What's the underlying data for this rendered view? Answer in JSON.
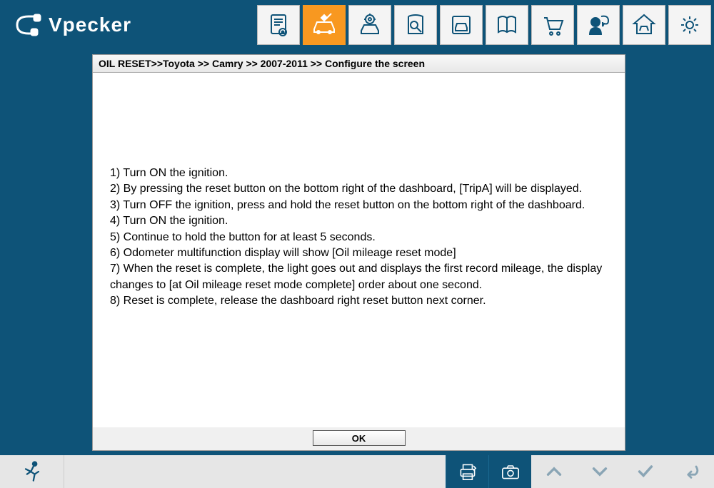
{
  "app": {
    "name": "Vpecker"
  },
  "toolbar": {
    "items": [
      {
        "name": "document-icon"
      },
      {
        "name": "car-wrench-icon"
      },
      {
        "name": "diagnose-car-icon"
      },
      {
        "name": "search-book-icon"
      },
      {
        "name": "car-record-icon"
      },
      {
        "name": "book-icon"
      },
      {
        "name": "cart-icon"
      },
      {
        "name": "user-chat-icon"
      },
      {
        "name": "home-icon"
      },
      {
        "name": "settings-icon"
      }
    ],
    "active_index": 1
  },
  "breadcrumb": "OIL RESET>>Toyota >> Camry >> 2007-2011 >> Configure the screen",
  "instructions": [
    "1) Turn ON the ignition.",
    "2) By pressing the reset button on the bottom right of the dashboard, [TripA] will be displayed.",
    "3) Turn OFF the ignition, press and hold the reset button on the bottom right of the dashboard.",
    "4) Turn ON the ignition.",
    "5) Continue to hold the button for at least 5 seconds.",
    "6) Odometer multifunction display will show [Oil mileage reset mode]",
    "7) When the reset is complete, the light goes out and displays the first record mileage, the display changes to [at Oil mileage reset mode complete] order about one second.",
    "8) Reset is complete, release the dashboard right reset button next corner."
  ],
  "buttons": {
    "ok": "OK"
  },
  "colors": {
    "brand": "#0e5378",
    "accent": "#f89820"
  }
}
